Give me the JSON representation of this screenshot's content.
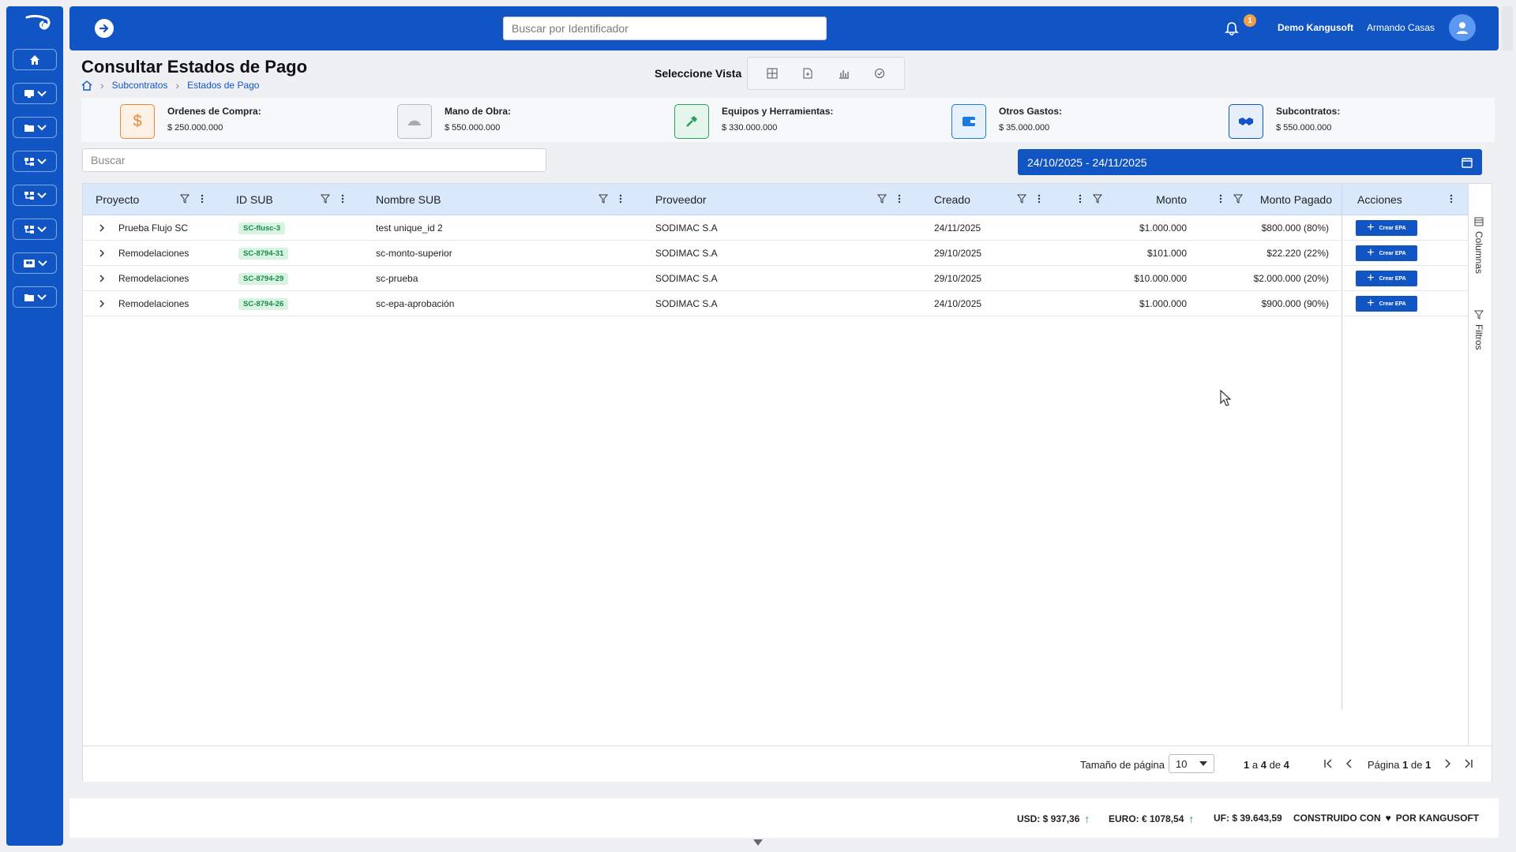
{
  "colors": {
    "primary": "#1155c4",
    "header_bg": "#d9e9fb",
    "badge_bg": "#d7f3e1",
    "badge_text": "#1b8a4b",
    "notif": "#f0a04b"
  },
  "sidebar": {
    "logo": "kangusoft-logo-icon",
    "items": [
      {
        "icon": "home-icon"
      },
      {
        "icon": "monitor-icon",
        "expand": "chevron-down-icon"
      },
      {
        "icon": "folder-icon",
        "expand": "chevron-down-icon"
      },
      {
        "icon": "hierarchy-icon",
        "expand": "chevron-down-icon"
      },
      {
        "icon": "hierarchy-icon",
        "expand": "chevron-down-icon"
      },
      {
        "icon": "hierarchy-icon",
        "expand": "chevron-down-icon"
      },
      {
        "icon": "people-icon",
        "expand": "chevron-down-icon"
      },
      {
        "icon": "folder-icon",
        "expand": "chevron-down-icon"
      }
    ]
  },
  "header": {
    "search_placeholder": "Buscar por Identificador",
    "notifications": "1",
    "company": "Demo Kangusoft",
    "user": "Armando Casas"
  },
  "page": {
    "title": "Consultar Estados de Pago",
    "breadcrumb": [
      "Subcontratos",
      "Estados de Pago"
    ],
    "view_label": "Seleccione Vista",
    "views": [
      "table-icon",
      "document-icon",
      "bar-chart-icon",
      "check-circle-icon"
    ]
  },
  "summary": [
    {
      "label": "Ordenes de Compra:",
      "value": "$ 250.000.000",
      "icon": "dollar-icon",
      "color": "#e8863a"
    },
    {
      "label": "Mano de Obra:",
      "value": "$ 550.000.000",
      "icon": "helmet-icon",
      "color": "#9aa0a6"
    },
    {
      "label": "Equipos y Herramientas:",
      "value": "$ 330.000.000",
      "icon": "hammer-icon",
      "color": "#2aa05a"
    },
    {
      "label": "Otros Gastos:",
      "value": "$ 35.000.000",
      "icon": "wallet-icon",
      "color": "#1c7be0"
    },
    {
      "label": "Subcontratos:",
      "value": "$ 550.000.000",
      "icon": "handshake-icon",
      "color": "#1155c4"
    }
  ],
  "search_placeholder": "Buscar",
  "date_range": "24/10/2025 - 24/11/2025",
  "columns": [
    "Proyecto",
    "ID SUB",
    "Nombre SUB",
    "Proveedor",
    "Creado",
    "Monto",
    "Monto Pagado",
    "Acciones"
  ],
  "rows": [
    {
      "proyecto": "Prueba Flujo SC",
      "id": "SC-flusc-3",
      "nombre": "test unique_id 2",
      "proveedor": "SODIMAC S.A",
      "creado": "24/11/2025",
      "monto": "$1.000.000",
      "pagado": "$800.000 (80%)",
      "accion": "Crear EPA"
    },
    {
      "proyecto": "Remodelaciones",
      "id": "SC-8794-31",
      "nombre": "sc-monto-superior",
      "proveedor": "SODIMAC S.A",
      "creado": "29/10/2025",
      "monto": "$101.000",
      "pagado": "$22.220 (22%)",
      "accion": "Crear EPA"
    },
    {
      "proyecto": "Remodelaciones",
      "id": "SC-8794-29",
      "nombre": "sc-prueba",
      "proveedor": "SODIMAC S.A",
      "creado": "29/10/2025",
      "monto": "$10.000.000",
      "pagado": "$2.000.000 (20%)",
      "accion": "Crear EPA"
    },
    {
      "proyecto": "Remodelaciones",
      "id": "SC-8794-26",
      "nombre": "sc-epa-aprobación",
      "proveedor": "SODIMAC S.A",
      "creado": "24/10/2025",
      "monto": "$1.000.000",
      "pagado": "$900.000 (90%)",
      "accion": "Crear EPA"
    }
  ],
  "side_tabs": {
    "columns": "Columnas",
    "filters": "Filtros"
  },
  "pagination": {
    "size_label": "Tamaño de página",
    "size": "10",
    "from": "1",
    "to": "4",
    "total": "4",
    "a": "a",
    "de": "de",
    "page_word": "Página",
    "page": "1",
    "pages": "1"
  },
  "footer": {
    "usd": "USD: $ 937,36",
    "euro": "EURO: € 1078,54",
    "uf": "UF: $ 39.643,59",
    "built_pre": "CONSTRUIDO CON",
    "built_post": "POR KANGUSOFT"
  }
}
